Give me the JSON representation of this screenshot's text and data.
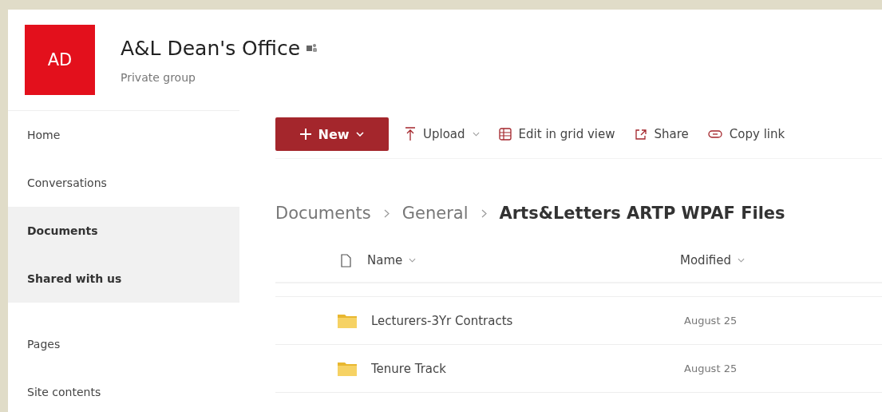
{
  "site": {
    "logo": "AD",
    "title": "A&L Dean's Office",
    "subtitle": "Private group"
  },
  "sidebar": {
    "items": [
      {
        "label": "Home",
        "selected": false
      },
      {
        "label": "Conversations",
        "selected": false
      },
      {
        "label": "Documents",
        "selected": true
      },
      {
        "label": "Shared with us",
        "selected": true
      },
      {
        "label": "Pages",
        "selected": false,
        "gap_before": true
      },
      {
        "label": "Site contents",
        "selected": false
      }
    ]
  },
  "toolbar": {
    "items": [
      {
        "kind": "primary",
        "label": "New"
      },
      {
        "kind": "upload",
        "label": "Upload"
      },
      {
        "kind": "grid",
        "label": "Edit in grid view"
      },
      {
        "kind": "share",
        "label": "Share"
      },
      {
        "kind": "link",
        "label": "Copy link"
      }
    ]
  },
  "breadcrumb": [
    "Documents",
    "General",
    "Arts&Letters ARTP WPAF Files"
  ],
  "table": {
    "columns": [
      "Name",
      "Modified"
    ],
    "rows": [
      {
        "name": "Lecturers-3Yr Contracts",
        "modified": "August 25"
      },
      {
        "name": "Tenure Track",
        "modified": "August 25"
      }
    ]
  }
}
